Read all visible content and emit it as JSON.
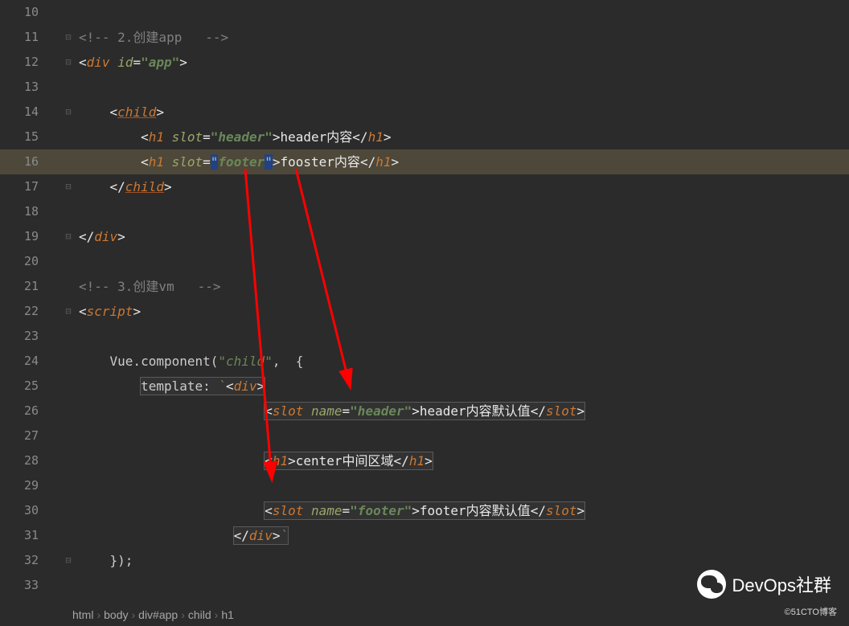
{
  "lines": [
    10,
    11,
    12,
    13,
    14,
    15,
    16,
    17,
    18,
    19,
    20,
    21,
    22,
    23,
    24,
    25,
    26,
    27,
    28,
    29,
    30,
    31,
    32,
    33
  ],
  "fold": [
    "",
    "⊟",
    "⊟",
    "",
    "⊟",
    "",
    "",
    "⊟",
    "",
    "⊟",
    "",
    "",
    "⊟",
    "",
    "",
    "",
    "",
    "",
    "",
    "",
    "",
    "",
    "⊟",
    ""
  ],
  "cmt1": "&lt;!-- 2.创建app   --&gt;",
  "cmt2": "&lt;!-- 3.创建vm   --&gt;",
  "t_div": "div",
  "t_child": "child",
  "t_h1": "h1",
  "t_script": "script",
  "t_slot": "slot",
  "a_id": "id",
  "a_slot": "slot",
  "a_name": "name",
  "v_app": "\"app\"",
  "v_header": "\"header\"",
  "v_footer": "\"footer\"",
  "txt_header": "header内容",
  "txt_fooster": "fooster内容",
  "txt_center": "center中间区域",
  "txt_hdef": "header内容默认值",
  "txt_fdef": "footer内容默认值",
  "vue": "Vue.",
  "comp": "component(",
  "child_str": "\"child\"",
  "comma": ",  {",
  "tmpl": "template: ",
  "btk": "`",
  "close": "});",
  "crumb": [
    "html",
    "body",
    "div#app",
    "child",
    "h1"
  ],
  "sep": "›",
  "brand": "DevOps社群",
  "watermark": "©51CTO博客"
}
